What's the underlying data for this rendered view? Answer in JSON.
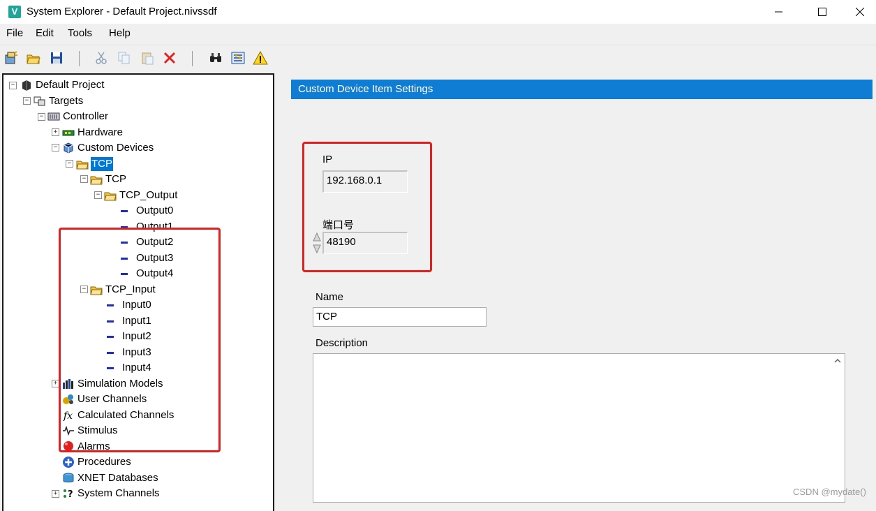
{
  "window": {
    "app_icon": "V",
    "title": "System Explorer - Default Project.nivssdf"
  },
  "menu": [
    "File",
    "Edit",
    "Tools",
    "Help"
  ],
  "toolbar_icons": [
    "new-project-icon",
    "open-folder-icon",
    "save-icon",
    "cut-icon",
    "copy-icon",
    "paste-icon",
    "delete-icon",
    "find-icon",
    "configure-icon",
    "warning-icon"
  ],
  "tree": {
    "root": "Default Project",
    "targets": "Targets",
    "controller": "Controller",
    "hardware": "Hardware",
    "custom_devices": "Custom Devices",
    "tcp_selected": "TCP",
    "tcp": "TCP",
    "tcp_output": "TCP_Output",
    "outputs": [
      "Output0",
      "Output1",
      "Output2",
      "Output3",
      "Output4"
    ],
    "tcp_input": "TCP_Input",
    "inputs": [
      "Input0",
      "Input1",
      "Input2",
      "Input3",
      "Input4"
    ],
    "simulation_models": "Simulation Models",
    "user_channels": "User Channels",
    "calculated_channels": "Calculated Channels",
    "stimulus": "Stimulus",
    "alarms": "Alarms",
    "procedures": "Procedures",
    "xnet_databases": "XNET Databases",
    "system_channels": "System Channels"
  },
  "settings": {
    "header": "Custom Device Item Settings",
    "ip_label": "IP",
    "ip_value": "192.168.0.1",
    "port_label": "端口号",
    "port_value": "48190",
    "name_label": "Name",
    "name_value": "TCP",
    "description_label": "Description",
    "description_value": ""
  },
  "watermark": "CSDN @mydate()",
  "colors": {
    "header": "#0f7dd4",
    "selection": "#0078d7",
    "highlight": "#e02020"
  }
}
